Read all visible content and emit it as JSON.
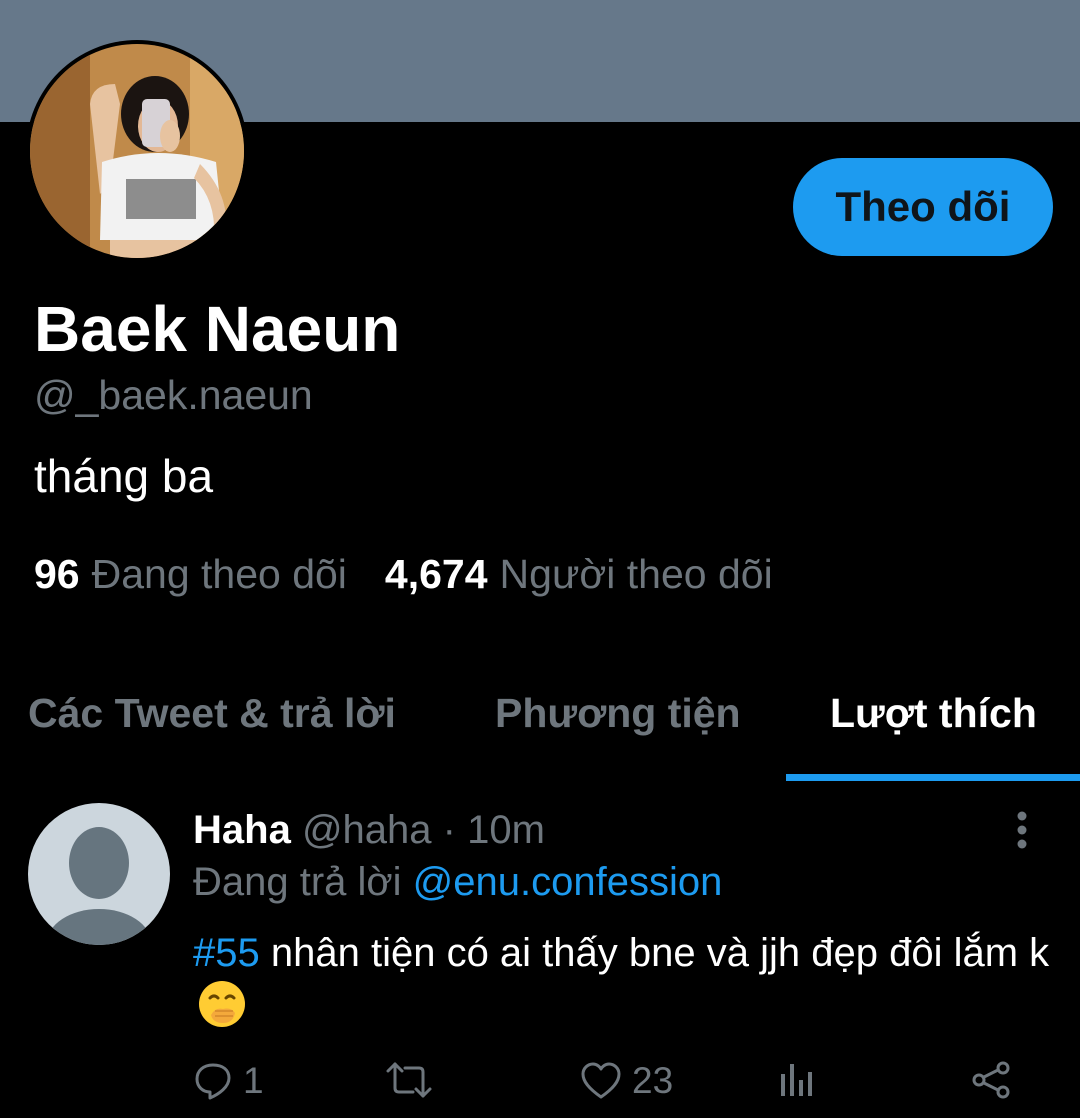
{
  "colors": {
    "background": "#000000",
    "banner": "#66788a",
    "accent": "#1d9bf0",
    "secondary_text": "#6e767d"
  },
  "profile": {
    "display_name": "Baek Naeun",
    "handle": "@_baek.naeun",
    "bio": "tháng ba",
    "follow_button_label": "Theo dõi",
    "following_count": "96",
    "following_label": "Đang theo dõi",
    "followers_count": "4,674",
    "followers_label": "Người theo dõi"
  },
  "tabs": [
    {
      "label": "Các Tweet & trả lời",
      "active": false
    },
    {
      "label": "Phương tiện",
      "active": false
    },
    {
      "label": "Lượt thích",
      "active": true
    }
  ],
  "tweet": {
    "author_name": "Haha",
    "author_handle": "@haha",
    "separator": "·",
    "time": "10m",
    "replying_label": "Đang trả lời",
    "replying_to": "@enu.confession",
    "hashtag": "#55",
    "text": " nhân tiện có ai thấy bne và jjh đẹp đôi lắm k",
    "emoji": "face-with-hand-over-mouth-emoji",
    "reply_count": "1",
    "like_count": "23",
    "icons": [
      "reply-icon",
      "retweet-icon",
      "like-icon",
      "stats-icon",
      "share-icon",
      "more-icon"
    ]
  }
}
